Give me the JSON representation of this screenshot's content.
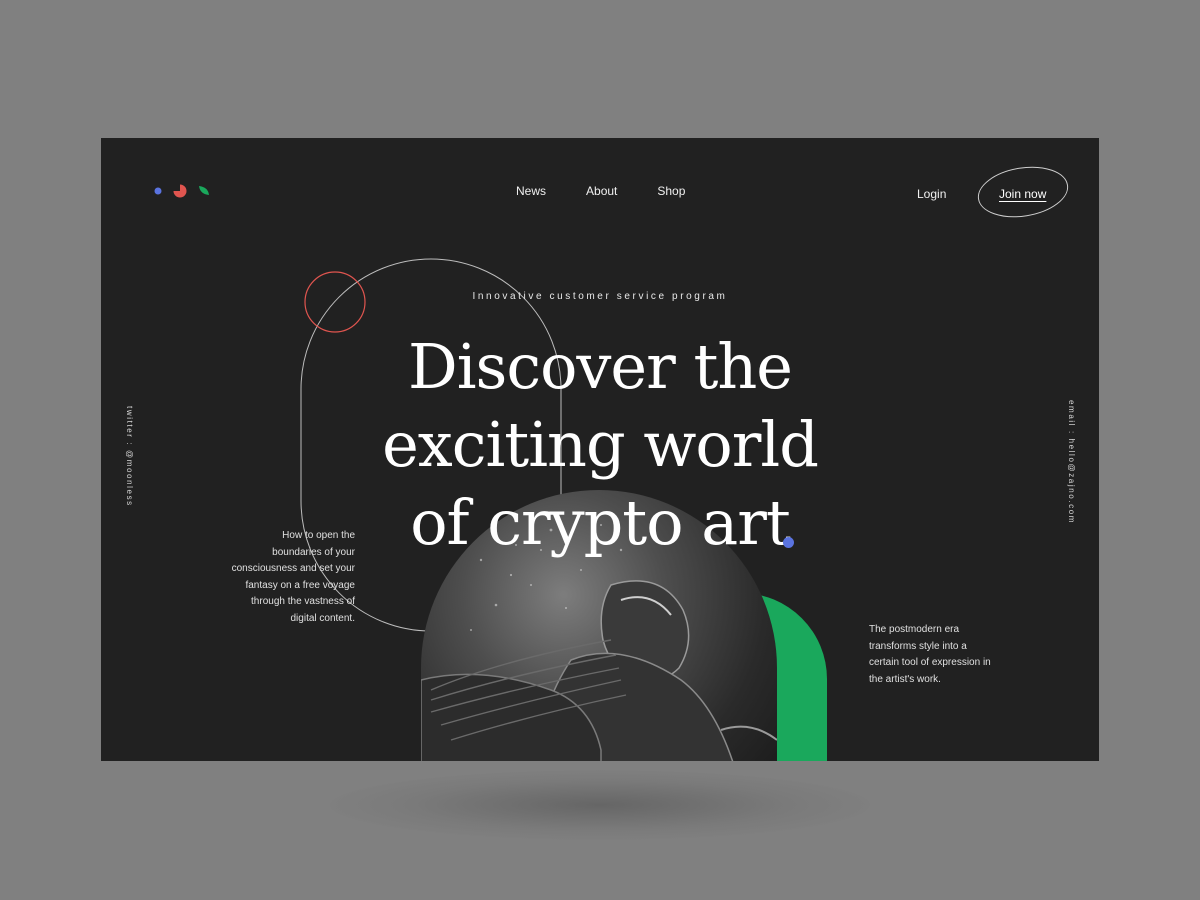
{
  "nav": {
    "news": "News",
    "about": "About",
    "shop": "Shop"
  },
  "auth": {
    "login": "Login",
    "join": "Join now"
  },
  "hero": {
    "tagline": "Innovative customer service program",
    "headline_line1": "Discover the",
    "headline_line2": "exciting world",
    "headline_line3": "of crypto art"
  },
  "side": {
    "left_text": "How to open the boundaries of your consciousness and set your fantasy on a free voyage through the vastness of digital content.",
    "right_text": "The postmodern era transforms style into a certain tool of expression in the artist's work.",
    "twitter": "twitter : @moonless",
    "email": "email : hello@zajno.com"
  },
  "colors": {
    "background": "#212121",
    "blue": "#5a73e0",
    "red": "#e0554f",
    "green": "#1aa85c"
  },
  "icons": {
    "logo": "three-shape-logo-icon"
  }
}
